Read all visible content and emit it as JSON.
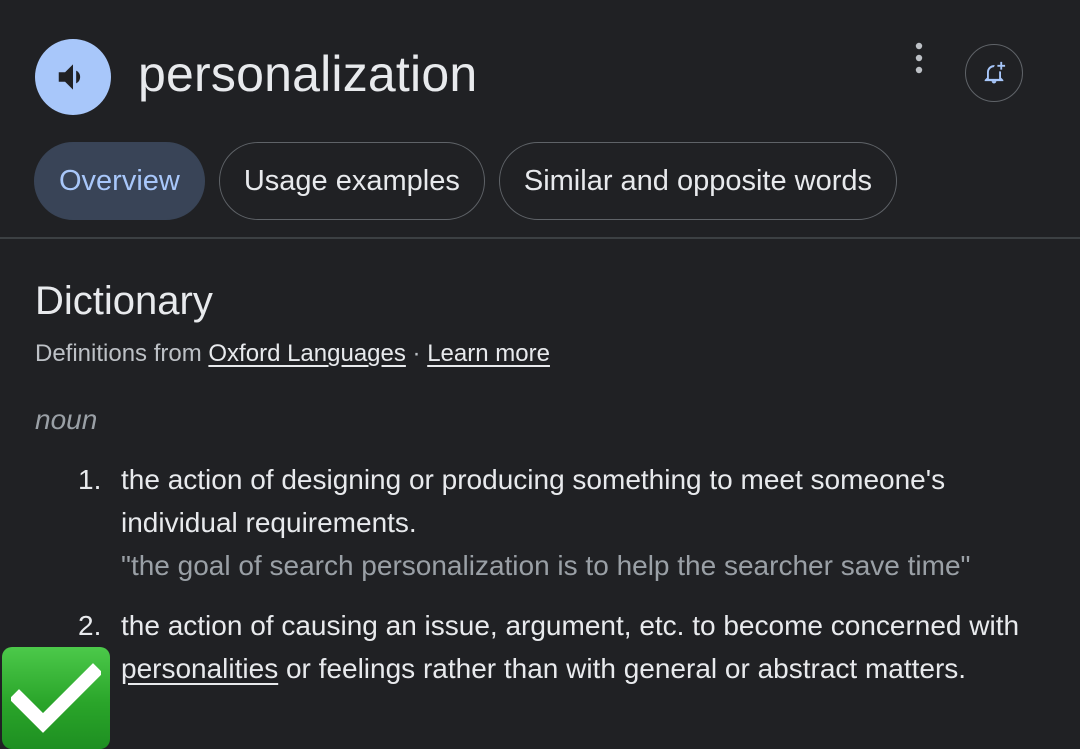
{
  "header": {
    "word": "personalization"
  },
  "tabs": [
    {
      "label": "Overview",
      "active": true
    },
    {
      "label": "Usage examples",
      "active": false
    },
    {
      "label": "Similar and opposite words",
      "active": false
    }
  ],
  "dictionary": {
    "title": "Dictionary",
    "source_prefix": "Definitions from ",
    "source_link": "Oxford Languages",
    "separator": " · ",
    "learn_more": "Learn more",
    "part_of_speech": "noun",
    "definitions": [
      {
        "number": "1.",
        "text": "the action of designing or producing something to meet someone's individual requirements.",
        "example": "\"the goal of search personalization is to help the searcher save time\""
      },
      {
        "number": "2.",
        "text_before": "the action of causing an issue, argument, etc. to become concerned with ",
        "link": "personalities",
        "text_after": " or feelings rather than with general or abstract matters."
      }
    ]
  },
  "colors": {
    "background": "#202124",
    "accent": "#a8c7fa",
    "active_tab_bg": "#394457",
    "check_green": "#2aa52a"
  },
  "icons": {
    "speaker": "speaker-icon",
    "more": "more-vert-icon",
    "bell": "bell-add-icon",
    "check": "checkmark-icon"
  }
}
